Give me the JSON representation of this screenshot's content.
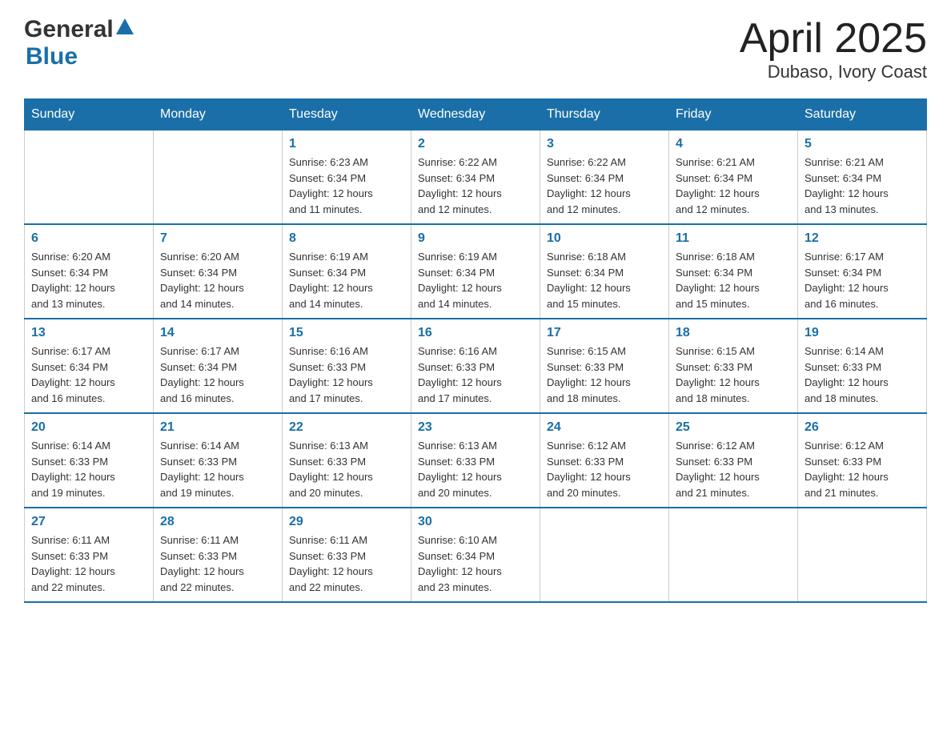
{
  "header": {
    "logo_general": "General",
    "logo_blue": "Blue",
    "title": "April 2025",
    "subtitle": "Dubaso, Ivory Coast"
  },
  "weekdays": [
    "Sunday",
    "Monday",
    "Tuesday",
    "Wednesday",
    "Thursday",
    "Friday",
    "Saturday"
  ],
  "weeks": [
    [
      {
        "day": "",
        "info": ""
      },
      {
        "day": "",
        "info": ""
      },
      {
        "day": "1",
        "info": "Sunrise: 6:23 AM\nSunset: 6:34 PM\nDaylight: 12 hours\nand 11 minutes."
      },
      {
        "day": "2",
        "info": "Sunrise: 6:22 AM\nSunset: 6:34 PM\nDaylight: 12 hours\nand 12 minutes."
      },
      {
        "day": "3",
        "info": "Sunrise: 6:22 AM\nSunset: 6:34 PM\nDaylight: 12 hours\nand 12 minutes."
      },
      {
        "day": "4",
        "info": "Sunrise: 6:21 AM\nSunset: 6:34 PM\nDaylight: 12 hours\nand 12 minutes."
      },
      {
        "day": "5",
        "info": "Sunrise: 6:21 AM\nSunset: 6:34 PM\nDaylight: 12 hours\nand 13 minutes."
      }
    ],
    [
      {
        "day": "6",
        "info": "Sunrise: 6:20 AM\nSunset: 6:34 PM\nDaylight: 12 hours\nand 13 minutes."
      },
      {
        "day": "7",
        "info": "Sunrise: 6:20 AM\nSunset: 6:34 PM\nDaylight: 12 hours\nand 14 minutes."
      },
      {
        "day": "8",
        "info": "Sunrise: 6:19 AM\nSunset: 6:34 PM\nDaylight: 12 hours\nand 14 minutes."
      },
      {
        "day": "9",
        "info": "Sunrise: 6:19 AM\nSunset: 6:34 PM\nDaylight: 12 hours\nand 14 minutes."
      },
      {
        "day": "10",
        "info": "Sunrise: 6:18 AM\nSunset: 6:34 PM\nDaylight: 12 hours\nand 15 minutes."
      },
      {
        "day": "11",
        "info": "Sunrise: 6:18 AM\nSunset: 6:34 PM\nDaylight: 12 hours\nand 15 minutes."
      },
      {
        "day": "12",
        "info": "Sunrise: 6:17 AM\nSunset: 6:34 PM\nDaylight: 12 hours\nand 16 minutes."
      }
    ],
    [
      {
        "day": "13",
        "info": "Sunrise: 6:17 AM\nSunset: 6:34 PM\nDaylight: 12 hours\nand 16 minutes."
      },
      {
        "day": "14",
        "info": "Sunrise: 6:17 AM\nSunset: 6:34 PM\nDaylight: 12 hours\nand 16 minutes."
      },
      {
        "day": "15",
        "info": "Sunrise: 6:16 AM\nSunset: 6:33 PM\nDaylight: 12 hours\nand 17 minutes."
      },
      {
        "day": "16",
        "info": "Sunrise: 6:16 AM\nSunset: 6:33 PM\nDaylight: 12 hours\nand 17 minutes."
      },
      {
        "day": "17",
        "info": "Sunrise: 6:15 AM\nSunset: 6:33 PM\nDaylight: 12 hours\nand 18 minutes."
      },
      {
        "day": "18",
        "info": "Sunrise: 6:15 AM\nSunset: 6:33 PM\nDaylight: 12 hours\nand 18 minutes."
      },
      {
        "day": "19",
        "info": "Sunrise: 6:14 AM\nSunset: 6:33 PM\nDaylight: 12 hours\nand 18 minutes."
      }
    ],
    [
      {
        "day": "20",
        "info": "Sunrise: 6:14 AM\nSunset: 6:33 PM\nDaylight: 12 hours\nand 19 minutes."
      },
      {
        "day": "21",
        "info": "Sunrise: 6:14 AM\nSunset: 6:33 PM\nDaylight: 12 hours\nand 19 minutes."
      },
      {
        "day": "22",
        "info": "Sunrise: 6:13 AM\nSunset: 6:33 PM\nDaylight: 12 hours\nand 20 minutes."
      },
      {
        "day": "23",
        "info": "Sunrise: 6:13 AM\nSunset: 6:33 PM\nDaylight: 12 hours\nand 20 minutes."
      },
      {
        "day": "24",
        "info": "Sunrise: 6:12 AM\nSunset: 6:33 PM\nDaylight: 12 hours\nand 20 minutes."
      },
      {
        "day": "25",
        "info": "Sunrise: 6:12 AM\nSunset: 6:33 PM\nDaylight: 12 hours\nand 21 minutes."
      },
      {
        "day": "26",
        "info": "Sunrise: 6:12 AM\nSunset: 6:33 PM\nDaylight: 12 hours\nand 21 minutes."
      }
    ],
    [
      {
        "day": "27",
        "info": "Sunrise: 6:11 AM\nSunset: 6:33 PM\nDaylight: 12 hours\nand 22 minutes."
      },
      {
        "day": "28",
        "info": "Sunrise: 6:11 AM\nSunset: 6:33 PM\nDaylight: 12 hours\nand 22 minutes."
      },
      {
        "day": "29",
        "info": "Sunrise: 6:11 AM\nSunset: 6:33 PM\nDaylight: 12 hours\nand 22 minutes."
      },
      {
        "day": "30",
        "info": "Sunrise: 6:10 AM\nSunset: 6:34 PM\nDaylight: 12 hours\nand 23 minutes."
      },
      {
        "day": "",
        "info": ""
      },
      {
        "day": "",
        "info": ""
      },
      {
        "day": "",
        "info": ""
      }
    ]
  ]
}
